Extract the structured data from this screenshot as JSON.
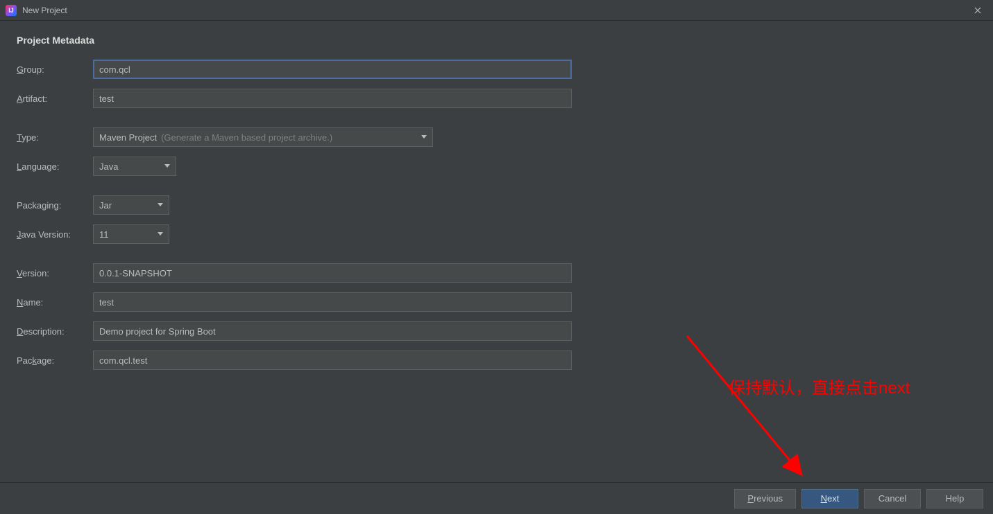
{
  "window": {
    "title": "New Project",
    "app_icon_text": "IJ"
  },
  "section": {
    "title": "Project Metadata"
  },
  "labels": {
    "group": "Group:",
    "artifact": "Artifact:",
    "type": "Type:",
    "language": "Language:",
    "packaging": "Packaging:",
    "javaVersion": "Java Version:",
    "version": "Version:",
    "name": "Name:",
    "description": "Description:",
    "package": "Package:"
  },
  "mnemonics": {
    "group": "G",
    "artifact": "A",
    "type": "T",
    "language": "L",
    "javaVersion": "J",
    "version": "V",
    "name": "N",
    "description": "D",
    "package": "k",
    "previous": "P",
    "next": "N"
  },
  "values": {
    "group": "com.qcl",
    "artifact": "test",
    "type": "Maven Project",
    "type_hint": "(Generate a Maven based project archive.)",
    "language": "Java",
    "packaging": "Jar",
    "javaVersion": "11",
    "version": "0.0.1-SNAPSHOT",
    "name": "test",
    "description": "Demo project for Spring Boot",
    "package": "com.qcl.test"
  },
  "buttons": {
    "previous": "Previous",
    "next": "Next",
    "cancel": "Cancel",
    "help": "Help"
  },
  "annotation": {
    "text": "保持默认，直接点击next"
  },
  "colors": {
    "accent": "#4a6ca0",
    "annotation": "#ff0000"
  }
}
